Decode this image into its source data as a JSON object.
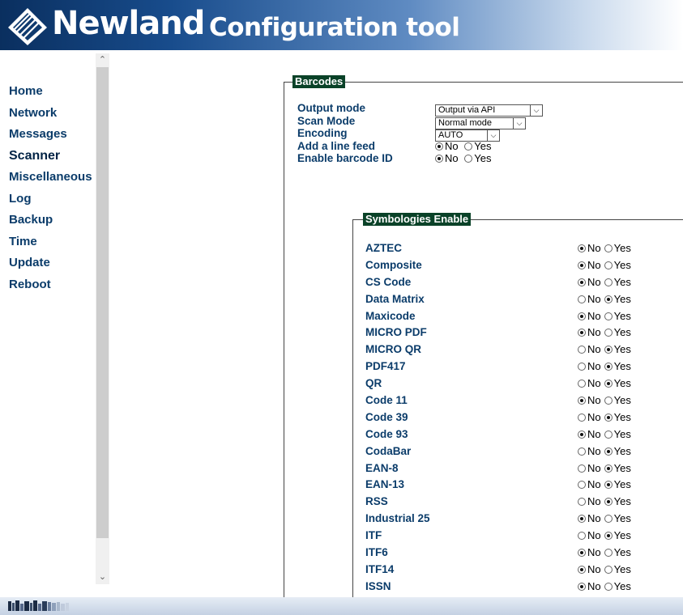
{
  "header": {
    "brand": "Newland",
    "title": "Configuration tool"
  },
  "nav": {
    "items": [
      {
        "label": "Home"
      },
      {
        "label": "Network"
      },
      {
        "label": "Messages"
      },
      {
        "label": "Scanner"
      },
      {
        "label": "Miscellaneous"
      },
      {
        "label": "Log"
      },
      {
        "label": "Backup"
      },
      {
        "label": "Time"
      },
      {
        "label": "Update"
      },
      {
        "label": "Reboot"
      }
    ],
    "active": "Scanner"
  },
  "barcodes": {
    "legend": "Barcodes",
    "output_mode": {
      "label": "Output mode",
      "value": "Output via API"
    },
    "scan_mode": {
      "label": "Scan Mode",
      "value": "Normal mode"
    },
    "encoding": {
      "label": "Encoding",
      "value": "AUTO"
    },
    "line_feed": {
      "label": "Add a line feed",
      "value": "No"
    },
    "barcode_id": {
      "label": "Enable barcode ID",
      "value": "No"
    }
  },
  "radio_options": {
    "no": "No",
    "yes": "Yes"
  },
  "symbologies": {
    "legend": "Symbologies Enable",
    "items": [
      {
        "label": "AZTEC",
        "value": "No"
      },
      {
        "label": "Composite",
        "value": "No"
      },
      {
        "label": "CS Code",
        "value": "No"
      },
      {
        "label": "Data Matrix",
        "value": "Yes"
      },
      {
        "label": "Maxicode",
        "value": "No"
      },
      {
        "label": "MICRO PDF",
        "value": "No"
      },
      {
        "label": "MICRO QR",
        "value": "Yes"
      },
      {
        "label": "PDF417",
        "value": "Yes"
      },
      {
        "label": "QR",
        "value": "Yes"
      },
      {
        "label": "Code 11",
        "value": "No"
      },
      {
        "label": "Code 39",
        "value": "Yes"
      },
      {
        "label": "Code 93",
        "value": "No"
      },
      {
        "label": "CodaBar",
        "value": "Yes"
      },
      {
        "label": "EAN-8",
        "value": "Yes"
      },
      {
        "label": "EAN-13",
        "value": "Yes"
      },
      {
        "label": "RSS",
        "value": "Yes"
      },
      {
        "label": "Industrial 25",
        "value": "No"
      },
      {
        "label": "ITF",
        "value": "Yes"
      },
      {
        "label": "ITF6",
        "value": "No"
      },
      {
        "label": "ITF14",
        "value": "No"
      },
      {
        "label": "ISSN",
        "value": "No"
      }
    ]
  },
  "colors": {
    "nav_text": "#0b3c6a",
    "legend_bg": "#0a4228",
    "header_dark": "#0a2f5f"
  }
}
